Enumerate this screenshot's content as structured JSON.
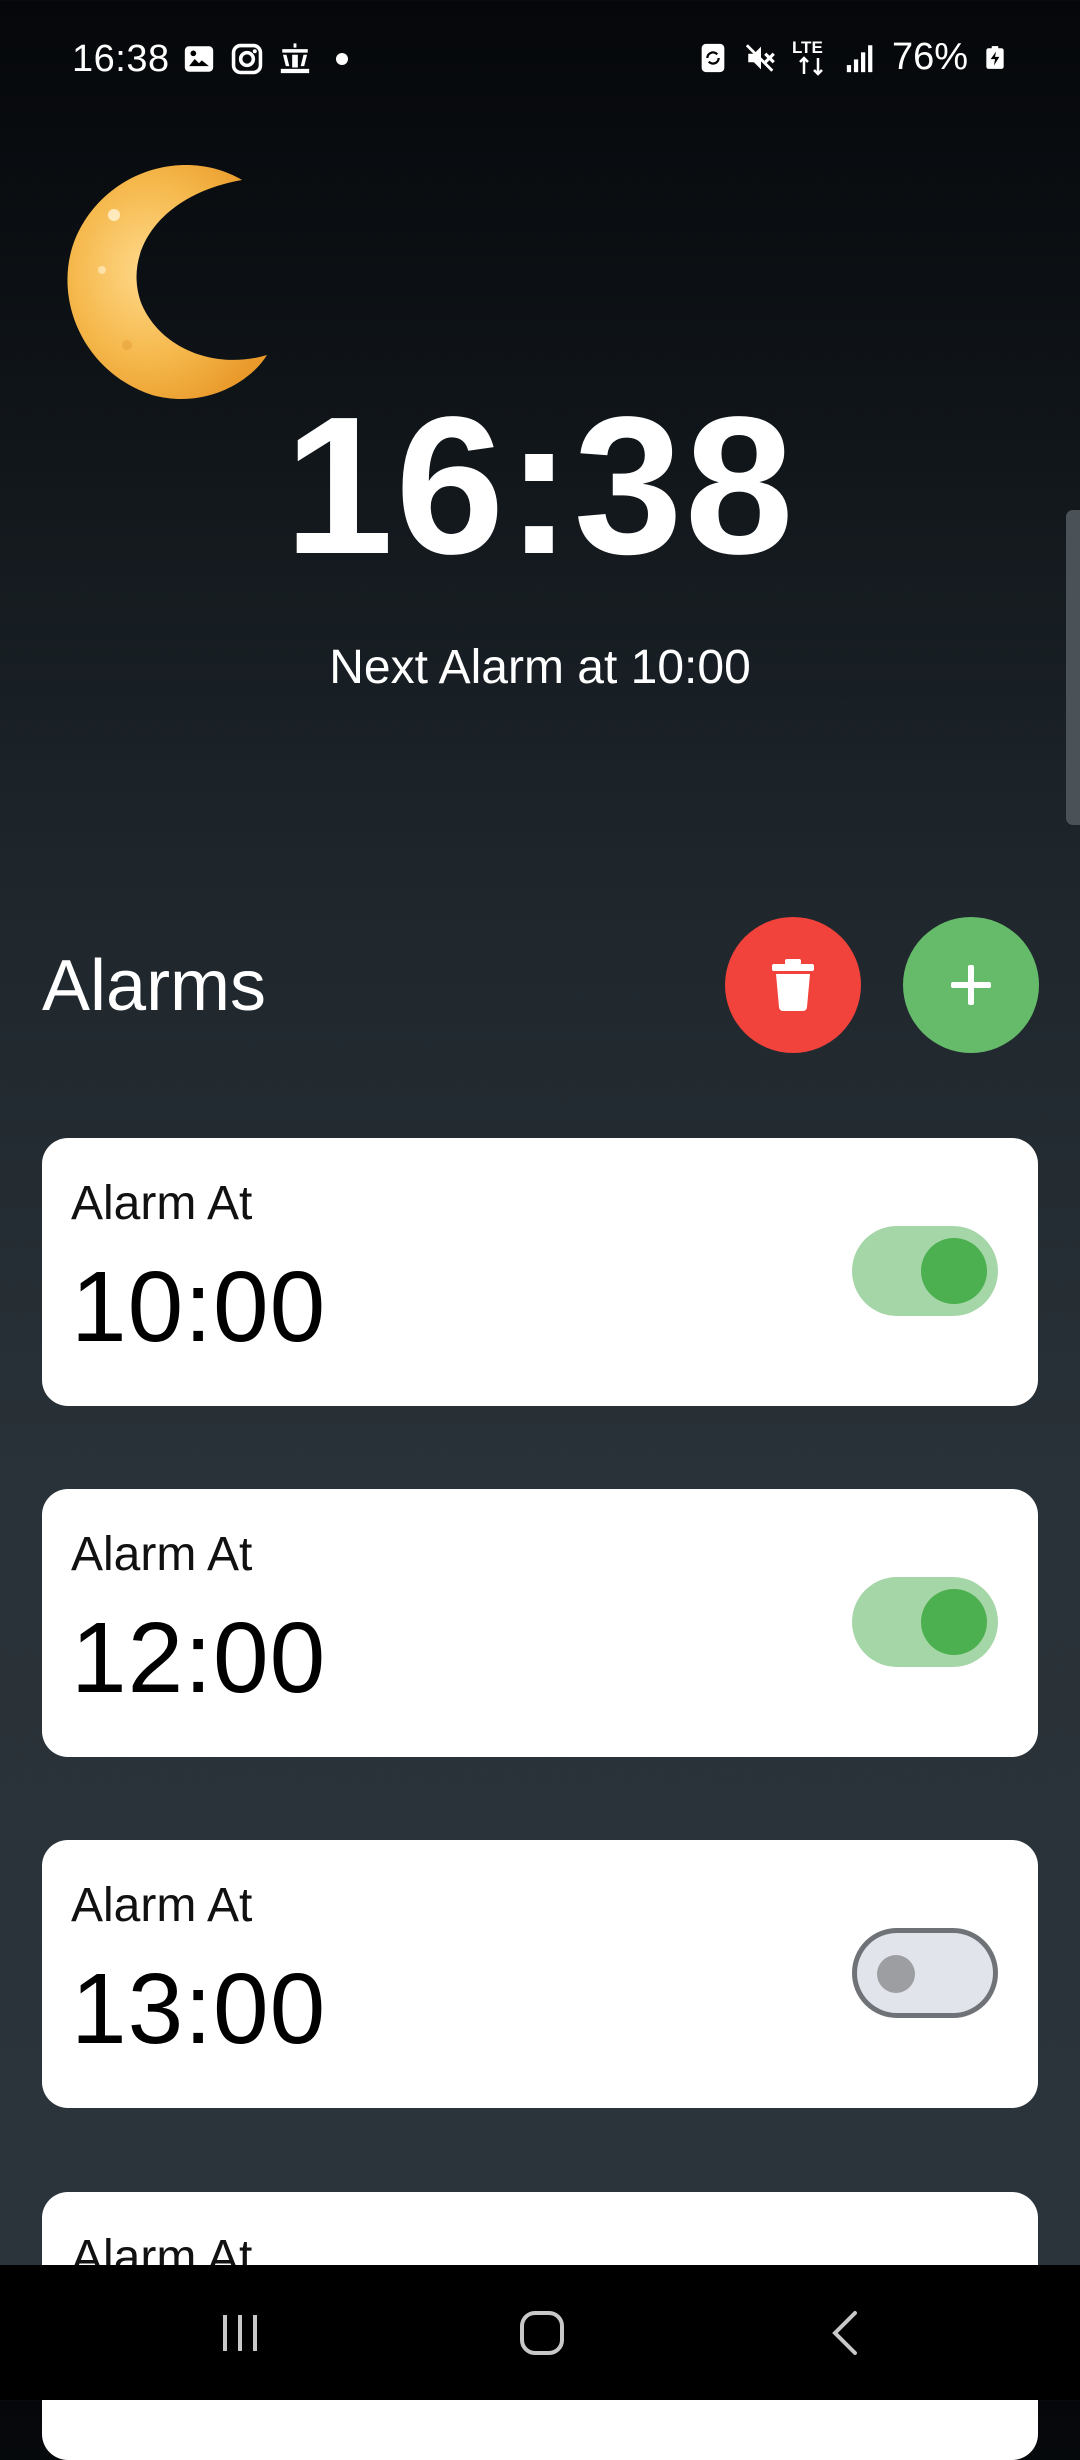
{
  "status_bar": {
    "time": "16:38",
    "left_icons": [
      "gallery-icon",
      "instagram-icon",
      "app-icon",
      "dot-icon"
    ],
    "right_icons": [
      "battery-saver-icon",
      "mute-icon",
      "lte-icon",
      "signal-icon",
      "battery-charging-icon"
    ],
    "lte": "LTE",
    "battery": "76%"
  },
  "header": {
    "clock": "16:38",
    "next_alarm": "Next Alarm at 10:00"
  },
  "alarms_section": {
    "title": "Alarms",
    "delete_icon": "trash-icon",
    "add_icon": "plus-icon",
    "delete_color": "#f1423b",
    "add_color": "#66bb6a"
  },
  "alarms": [
    {
      "label": "Alarm At",
      "time": "10:00",
      "enabled": true
    },
    {
      "label": "Alarm At",
      "time": "12:00",
      "enabled": true
    },
    {
      "label": "Alarm At",
      "time": "13:00",
      "enabled": false
    },
    {
      "label": "Alarm At",
      "time": "",
      "enabled": null
    }
  ],
  "nav_bar": {
    "buttons": [
      "recents-icon",
      "home-icon",
      "back-icon"
    ]
  }
}
